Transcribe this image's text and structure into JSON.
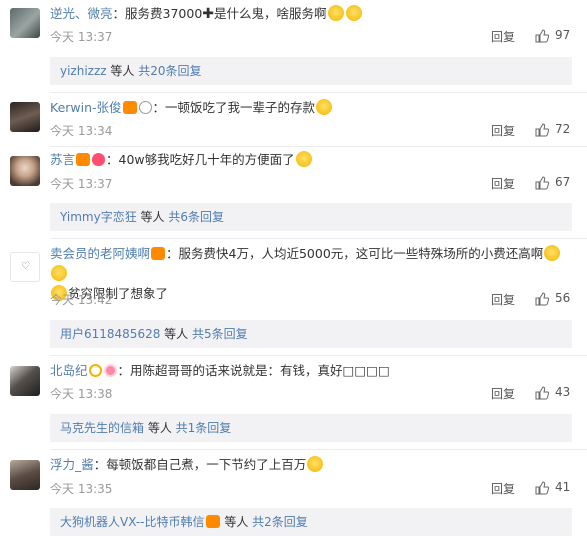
{
  "comments": [
    {
      "author": "逆光、微亮",
      "text_a": "：服务费37000",
      "plus": "✚",
      "text_b": "是什么鬼，啥服务啊",
      "time": "今天 13:37",
      "reply": "回复",
      "likes": "97",
      "sub_user": "yizhizzz",
      "sub_mid": " 等人 ",
      "sub_count": "共20条回复"
    },
    {
      "author": "Kerwin-张俊",
      "text": "：一顿饭吃了我一辈子的存款",
      "time": "今天 13:34",
      "reply": "回复",
      "likes": "72"
    },
    {
      "author": "苏言",
      "text": "：40w够我吃好几十年的方便面了",
      "time": "今天 13:37",
      "reply": "回复",
      "likes": "67",
      "sub_user": "Yimmy字恋狂",
      "sub_mid": " 等人 ",
      "sub_count": "共6条回复"
    },
    {
      "author": "卖会员的老阿姨啊",
      "text": "：服务费快4万，人均近5000元，这可比一些特殊场所的小费还高啊",
      "text2": "贫穷限制了想象了",
      "time": "今天 13:42",
      "reply": "回复",
      "likes": "56",
      "sub_user": "用户6118485628",
      "sub_mid": " 等人 ",
      "sub_count": "共5条回复"
    },
    {
      "author": "北岛纪",
      "text": "：用陈超哥哥的话来说就是：有钱，真好□□□□",
      "time": "今天 13:38",
      "reply": "回复",
      "likes": "43",
      "sub_user": "马克先生的信箱",
      "sub_mid": " 等人 ",
      "sub_count": "共1条回复"
    },
    {
      "author": "浮力_酱",
      "text": "：每顿饭都自己煮，一下节约了上百万",
      "time": "今天 13:35",
      "reply": "回复",
      "likes": "41",
      "sub_user": "大狗机器人VX--比特币韩信",
      "sub_mid": " 等人 ",
      "sub_count": "共2条回复"
    }
  ]
}
